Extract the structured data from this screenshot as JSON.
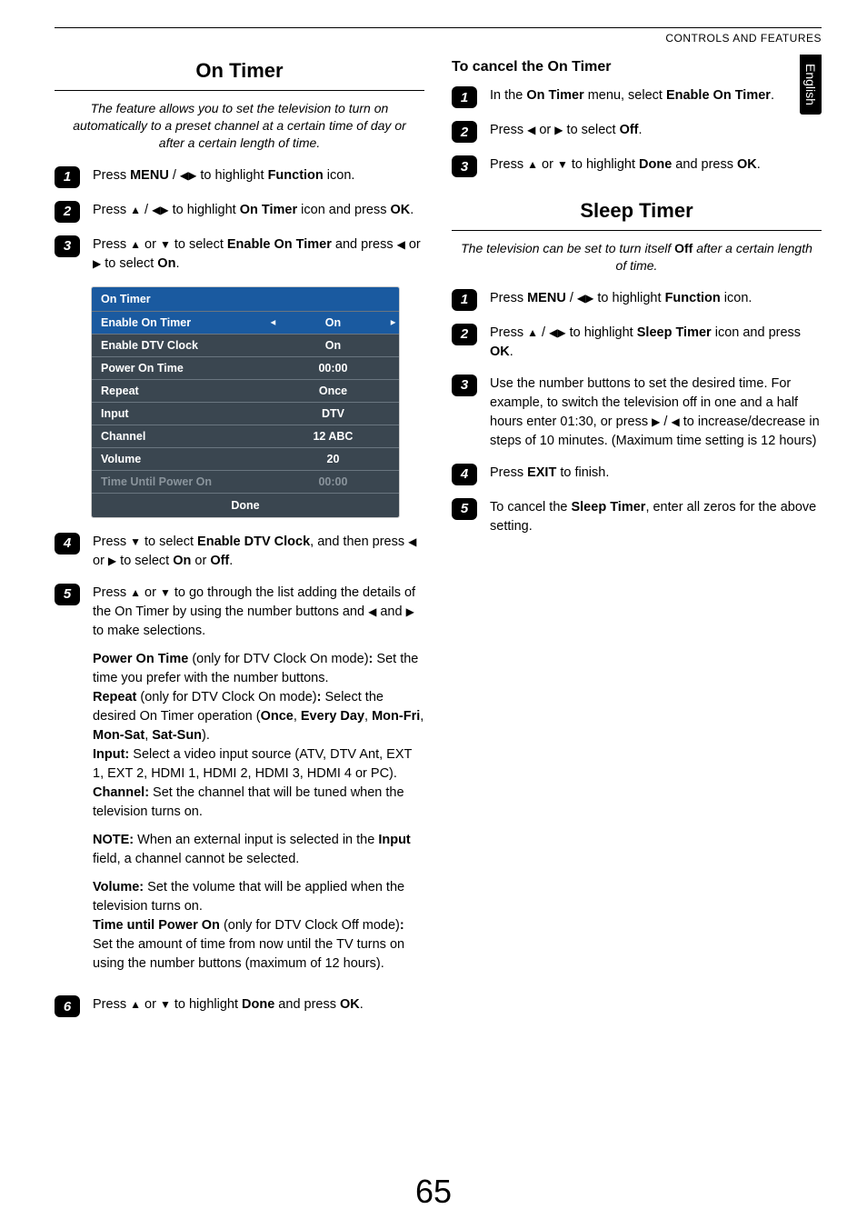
{
  "header": {
    "running": "CONTROLS AND FEATURES",
    "langTab": "English"
  },
  "pageNumber": "65",
  "left": {
    "title": "On Timer",
    "intro": "The feature allows you to set the television to turn on automatically to a preset channel at a certain time of day or after a certain length of time.",
    "steps": {
      "s1": {
        "pre": "Press ",
        "menu": "MENU",
        "mid": " / ",
        "post": " to highlight ",
        "func": "Function",
        "end": " icon."
      },
      "s2": {
        "pre": "Press ",
        "mid": " / ",
        "post": " to highlight ",
        "item": "On Timer",
        "end": " icon and press ",
        "ok": "OK",
        "dot": "."
      },
      "s3": {
        "pre": "Press ",
        "mid": " or ",
        "post": " to select ",
        "item": "Enable On Timer",
        "mid2": " and press ",
        "mid3": " or ",
        "post2": " to select ",
        "on": "On",
        "dot": "."
      },
      "s4": {
        "pre": "Press ",
        "mid": " to select ",
        "item": "Enable DTV Clock",
        "mid2": ", and then press ",
        "mid3": " or ",
        "post": " to select ",
        "on": "On",
        "or": " or ",
        "off": "Off",
        "dot": "."
      },
      "s5": {
        "line1": {
          "pre": "Press ",
          "or": " or ",
          "post": " to go through the list adding the details of the On Timer by using the number buttons and ",
          "and": " and ",
          "end": " to make selections."
        },
        "para1": {
          "b1": "Power On Time",
          "t1": " (only for DTV Clock On mode)",
          "b2": ":",
          "t2": " Set the time you prefer with the number buttons."
        },
        "para2": {
          "b1": "Repeat",
          "t1": " (only for DTV Clock On mode)",
          "b2": ":",
          "t2": " Select the desired On Timer operation (",
          "o1": "Once",
          "c1": ", ",
          "o2": "Every Day",
          "c2": ", ",
          "o3": "Mon-Fri",
          "c3": ", ",
          "o4": "Mon-Sat",
          "c4": ", ",
          "o5": "Sat-Sun",
          "t3": ")."
        },
        "para3": {
          "b1": "Input:",
          "t1": " Select a video input source (ATV, DTV Ant, EXT 1, EXT 2, HDMI 1, HDMI 2, HDMI 3, HDMI 4 or PC)."
        },
        "para4": {
          "b1": "Channel:",
          "t1": " Set the channel that will be tuned when the television turns on."
        },
        "note": {
          "b1": "NOTE:",
          "t1": " When an external input is selected in the ",
          "b2": "Input",
          "t2": " field, a channel cannot be selected."
        },
        "para5": {
          "b1": "Volume:",
          "t1": " Set the volume that will be applied when the television turns on."
        },
        "para6": {
          "b1": "Time until Power On",
          "t1": " (only for DTV Clock Off mode)",
          "b2": ":",
          "t2": " Set the amount of time from now until the TV turns on using the number buttons (maximum of 12 hours)."
        }
      },
      "s6": {
        "pre": "Press ",
        "or": " or ",
        "post": " to highlight ",
        "done": "Done",
        "mid": " and press ",
        "ok": "OK",
        "dot": "."
      }
    },
    "osd": {
      "title": "On Timer",
      "rows": [
        {
          "label": "Enable On Timer",
          "value": "On",
          "selected": true
        },
        {
          "label": "Enable DTV Clock",
          "value": "On"
        },
        {
          "label": "Power On Time",
          "value": "00:00"
        },
        {
          "label": "Repeat",
          "value": "Once"
        },
        {
          "label": "Input",
          "value": "DTV"
        },
        {
          "label": "Channel",
          "value": "12 ABC"
        },
        {
          "label": "Volume",
          "value": "20"
        },
        {
          "label": "Time Until Power On",
          "value": "00:00",
          "disabled": true
        }
      ],
      "done": "Done"
    }
  },
  "right": {
    "cancel": {
      "title": "To cancel the On Timer",
      "s1": {
        "pre": "In the ",
        "menu": "On Timer",
        "mid": " menu, select ",
        "item": "Enable On Timer",
        "dot": "."
      },
      "s2": {
        "pre": "Press ",
        "or": " or ",
        "post": " to select ",
        "off": "Off",
        "dot": "."
      },
      "s3": {
        "pre": "Press ",
        "or": " or ",
        "post": " to highlight ",
        "done": "Done",
        "mid": " and press ",
        "ok": "OK",
        "dot": "."
      }
    },
    "sleep": {
      "title": "Sleep Timer",
      "intro": {
        "pre": "The television can be set to turn itself ",
        "off": "Off",
        "post": " after a certain length of time."
      },
      "s1": {
        "pre": "Press ",
        "menu": "MENU",
        "mid": " / ",
        "post": " to highlight ",
        "func": "Function",
        "end": " icon."
      },
      "s2": {
        "pre": "Press ",
        "mid": " / ",
        "post": " to highlight ",
        "item": "Sleep Timer",
        "end": " icon and press ",
        "ok": "OK",
        "dot": "."
      },
      "s3": {
        "text": "Use the number buttons to set the desired time. For example, to switch the television off in one and a half hours enter 01:30, or press ",
        "mid": " / ",
        "text2": " to increase/decrease in steps of 10 minutes. (Maximum time setting is 12 hours)"
      },
      "s4": {
        "pre": "Press ",
        "exit": "EXIT",
        "post": " to finish."
      },
      "s5": {
        "pre": "To cancel the ",
        "item": "Sleep Timer",
        "post": ", enter all zeros for the above setting."
      }
    }
  }
}
